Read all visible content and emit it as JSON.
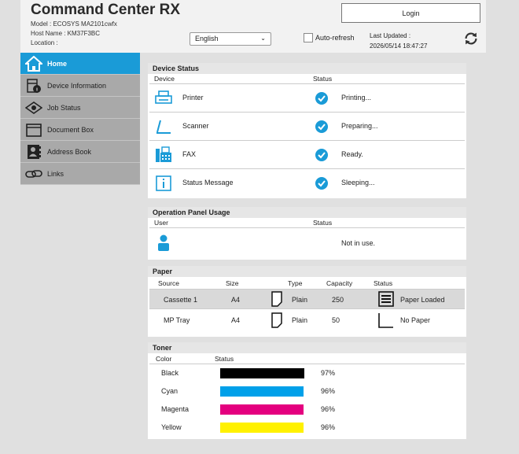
{
  "header": {
    "app_title": "Command Center RX",
    "model": "Model : ECOSYS MA2101cwfx",
    "host": "Host Name : KM37F3BC",
    "location": "Location :",
    "language": "English",
    "auto_refresh_label": "Auto-refresh",
    "auto_refresh_checked": false,
    "login_label": "Login",
    "last_updated_label": "Last Updated :",
    "last_updated_value": "2026/05/14 18:47:27"
  },
  "sidebar": {
    "items": [
      {
        "label": "Home",
        "icon": "home-icon"
      },
      {
        "label": "Device Information",
        "icon": "device-info-icon"
      },
      {
        "label": "Job Status",
        "icon": "eye-icon"
      },
      {
        "label": "Document Box",
        "icon": "folder-icon"
      },
      {
        "label": "Address Book",
        "icon": "address-book-icon"
      },
      {
        "label": "Links",
        "icon": "link-icon"
      }
    ]
  },
  "device_status": {
    "title": "Device Status",
    "col_device": "Device",
    "col_status": "Status",
    "rows": [
      {
        "device": "Printer",
        "status": "Printing...",
        "icon": "printer-icon"
      },
      {
        "device": "Scanner",
        "status": "Preparing...",
        "icon": "scanner-icon"
      },
      {
        "device": "FAX",
        "status": "Ready.",
        "icon": "fax-icon"
      },
      {
        "device": "Status Message",
        "status": "Sleeping...",
        "icon": "info-icon"
      }
    ]
  },
  "panel_usage": {
    "title": "Operation Panel Usage",
    "col_user": "User",
    "col_status": "Status",
    "status": "Not in use."
  },
  "paper": {
    "title": "Paper",
    "cols": [
      "Source",
      "Size",
      "Type",
      "Capacity",
      "Status"
    ],
    "rows": [
      {
        "source": "Cassette 1",
        "size": "A4",
        "type": "Plain",
        "capacity": "250",
        "status": "Paper Loaded"
      },
      {
        "source": "MP Tray",
        "size": "A4",
        "type": "Plain",
        "capacity": "50",
        "status": "No Paper"
      }
    ]
  },
  "toner": {
    "title": "Toner",
    "col_color": "Color",
    "col_status": "Status",
    "rows": [
      {
        "color": "Black",
        "percent": "97%",
        "level": 0.97,
        "hex": "#000000"
      },
      {
        "color": "Cyan",
        "percent": "96%",
        "level": 0.96,
        "hex": "#00a0e9"
      },
      {
        "color": "Magenta",
        "percent": "96%",
        "level": 0.96,
        "hex": "#e4007f"
      },
      {
        "color": "Yellow",
        "percent": "96%",
        "level": 0.96,
        "hex": "#fff100"
      }
    ]
  },
  "colors": {
    "accent": "#1a9bd7",
    "sidebar": "#a9a9a9"
  }
}
